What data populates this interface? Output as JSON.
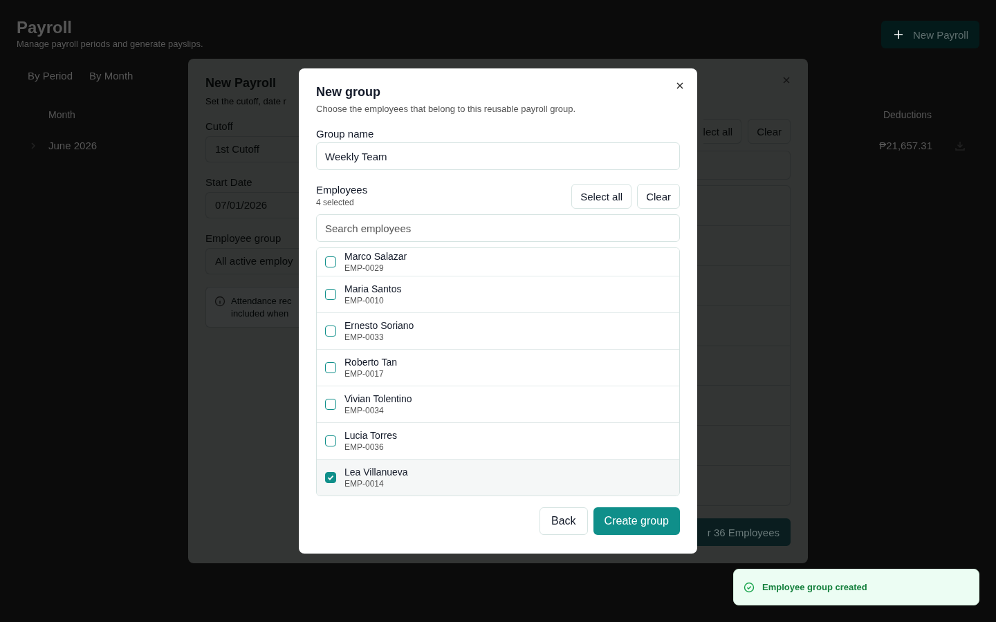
{
  "page": {
    "title": "Payroll",
    "subtitle": "Manage payroll periods and generate payslips.",
    "new_button": "New Payroll",
    "tabs": [
      "By Period",
      "By Month"
    ],
    "table": {
      "columns": [
        "Month",
        "Deductions"
      ],
      "rows": [
        {
          "month": "June 2026",
          "deductions": "₱21,657.31"
        }
      ]
    }
  },
  "payroll_dialog": {
    "title": "New Payroll",
    "subtitle": "Set the cutoff, date r",
    "fields": [
      {
        "label": "Cutoff",
        "value": "1st Cutoff"
      },
      {
        "label": "Start Date",
        "value": "07/01/2026"
      },
      {
        "label": "Employee group",
        "value": "All active employ"
      }
    ],
    "note": [
      "Attendance rec",
      "included when"
    ],
    "actions": [
      "lect all",
      "Clear"
    ],
    "submit": "r 36 Employees"
  },
  "group_dialog": {
    "title": "New group",
    "subtitle": "Choose the employees that belong to this reusable payroll group.",
    "name_label": "Group name",
    "name_value": "Weekly Team",
    "employees_label": "Employees",
    "selected_count": "4 selected",
    "actions": [
      "Select all",
      "Clear"
    ],
    "search_placeholder": "Search employees",
    "employees": [
      {
        "name": "Marco Salazar",
        "id": "EMP-0029",
        "checked": false
      },
      {
        "name": "Maria Santos",
        "id": "EMP-0010",
        "checked": false
      },
      {
        "name": "Ernesto Soriano",
        "id": "EMP-0033",
        "checked": false
      },
      {
        "name": "Roberto Tan",
        "id": "EMP-0017",
        "checked": false
      },
      {
        "name": "Vivian Tolentino",
        "id": "EMP-0034",
        "checked": false
      },
      {
        "name": "Lucia Torres",
        "id": "EMP-0036",
        "checked": false
      },
      {
        "name": "Lea Villanueva",
        "id": "EMP-0014",
        "checked": true
      }
    ],
    "back": "Back",
    "create": "Create group"
  },
  "toast": {
    "message": "Employee group created"
  }
}
